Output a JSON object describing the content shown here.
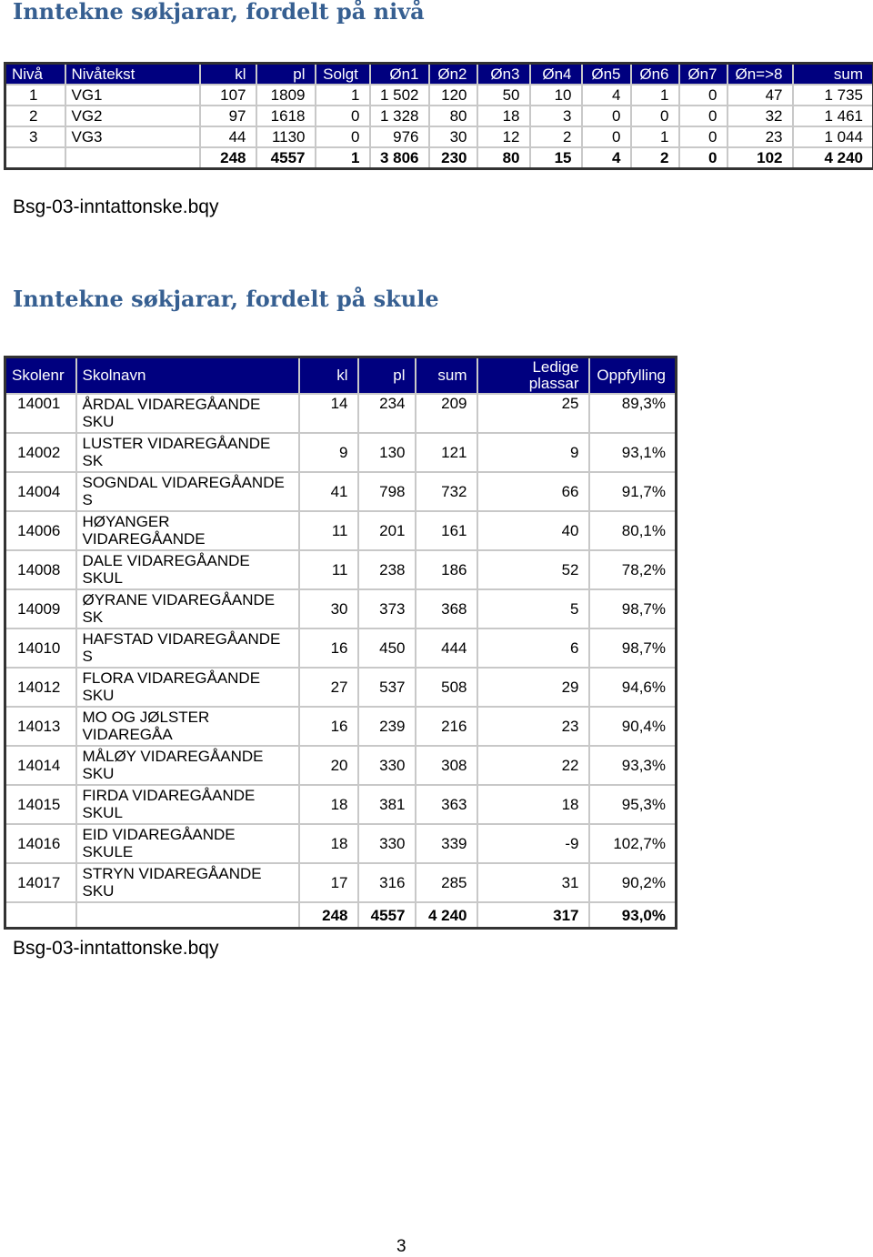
{
  "section1": {
    "title": "Inntekne søkjarar, fordelt på nivå",
    "headers": [
      "Nivå",
      "Nivåtekst",
      "kl",
      "pl",
      "Solgt",
      "Øn1",
      "Øn2",
      "Øn3",
      "Øn4",
      "Øn5",
      "Øn6",
      "Øn7",
      "Øn=>8",
      "sum"
    ],
    "rows": [
      [
        "1",
        "VG1",
        "107",
        "1809",
        "1",
        "1 502",
        "120",
        "50",
        "10",
        "4",
        "1",
        "0",
        "47",
        "1 735"
      ],
      [
        "2",
        "VG2",
        "97",
        "1618",
        "0",
        "1 328",
        "80",
        "18",
        "3",
        "0",
        "0",
        "0",
        "32",
        "1 461"
      ],
      [
        "3",
        "VG3",
        "44",
        "1130",
        "0",
        "976",
        "30",
        "12",
        "2",
        "0",
        "1",
        "0",
        "23",
        "1 044"
      ]
    ],
    "total": [
      "",
      "",
      "248",
      "4557",
      "1",
      "3 806",
      "230",
      "80",
      "15",
      "4",
      "2",
      "0",
      "102",
      "4 240"
    ],
    "source": "Bsg-03-inntattonske.bqy"
  },
  "section2": {
    "title": "Inntekne søkjarar, fordelt på skule",
    "headers": [
      "Skolenr",
      "Skolnavn",
      "kl",
      "pl",
      "sum",
      "Ledige plassar",
      "Oppfylling"
    ],
    "rows": [
      [
        "14001",
        "ÅRDAL VIDAREGÅANDE SKU",
        "14",
        "234",
        "209",
        "25",
        "89,3%"
      ],
      [
        "14002",
        "LUSTER VIDAREGÅANDE SK",
        "9",
        "130",
        "121",
        "9",
        "93,1%"
      ],
      [
        "14004",
        "SOGNDAL VIDAREGÅANDE S",
        "41",
        "798",
        "732",
        "66",
        "91,7%"
      ],
      [
        "14006",
        "HØYANGER VIDAREGÅANDE",
        "11",
        "201",
        "161",
        "40",
        "80,1%"
      ],
      [
        "14008",
        "DALE VIDAREGÅANDE SKUL",
        "11",
        "238",
        "186",
        "52",
        "78,2%"
      ],
      [
        "14009",
        "ØYRANE VIDAREGÅANDE SK",
        "30",
        "373",
        "368",
        "5",
        "98,7%"
      ],
      [
        "14010",
        "HAFSTAD VIDAREGÅANDE S",
        "16",
        "450",
        "444",
        "6",
        "98,7%"
      ],
      [
        "14012",
        "FLORA VIDAREGÅANDE SKU",
        "27",
        "537",
        "508",
        "29",
        "94,6%"
      ],
      [
        "14013",
        "MO OG JØLSTER VIDAREGÅA",
        "16",
        "239",
        "216",
        "23",
        "90,4%"
      ],
      [
        "14014",
        "MÅLØY VIDAREGÅANDE SKU",
        "20",
        "330",
        "308",
        "22",
        "93,3%"
      ],
      [
        "14015",
        "FIRDA VIDAREGÅANDE SKUL",
        "18",
        "381",
        "363",
        "18",
        "95,3%"
      ],
      [
        "14016",
        "EID VIDAREGÅANDE SKULE",
        "18",
        "330",
        "339",
        "-9",
        "102,7%"
      ],
      [
        "14017",
        "STRYN VIDAREGÅANDE SKU",
        "17",
        "316",
        "285",
        "31",
        "90,2%"
      ]
    ],
    "total": [
      "",
      "",
      "248",
      "4557",
      "4 240",
      "317",
      "93,0%"
    ],
    "source": "Bsg-03-inntattonske.bqy"
  },
  "page_number": "3",
  "colors": {
    "header_bg": "#00007f",
    "title": "#365f91"
  }
}
